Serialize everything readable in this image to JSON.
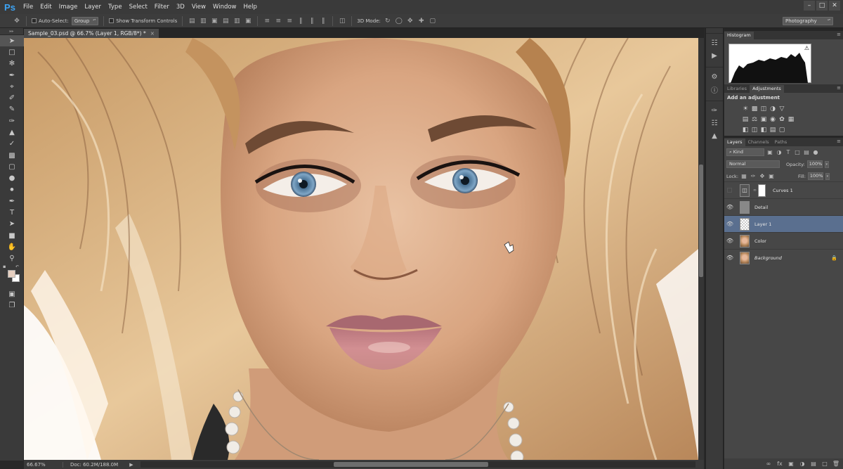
{
  "app": {
    "logo": "Ps"
  },
  "menu": [
    "File",
    "Edit",
    "Image",
    "Layer",
    "Type",
    "Select",
    "Filter",
    "3D",
    "View",
    "Window",
    "Help"
  ],
  "window_controls": {
    "minimize": "–",
    "restore": "□",
    "close": "✕"
  },
  "options": {
    "auto_select_label": "Auto-Select:",
    "auto_select_value": "Group",
    "show_transform_label": "Show Transform Controls",
    "mode_3d_label": "3D Mode:",
    "workspace": "Photography"
  },
  "document": {
    "tab_title": "Sample_03.psd @ 66.7% (Layer 1, RGB/8*) *",
    "close": "×"
  },
  "status": {
    "zoom": "66.67%",
    "doc": "Doc: 60.2M/188.0M",
    "arrow": "▶"
  },
  "histogram": {
    "tab": "Histogram",
    "warning_icon": "⚠"
  },
  "adjustments": {
    "tabs": [
      "Libraries",
      "Adjustments"
    ],
    "title": "Add an adjustment"
  },
  "layers": {
    "tabs": [
      "Layers",
      "Channels",
      "Paths"
    ],
    "kind": "⌕ Kind",
    "blend_mode": "Normal",
    "opacity_label": "Opacity:",
    "opacity_value": "100%",
    "lock_label": "Lock:",
    "fill_label": "Fill:",
    "fill_value": "100%",
    "items": [
      {
        "name": "Curves 1",
        "visible": false
      },
      {
        "name": "Detail",
        "visible": true
      },
      {
        "name": "Layer 1",
        "visible": true,
        "selected": true
      },
      {
        "name": "Color",
        "visible": true
      },
      {
        "name": "Background",
        "visible": true,
        "locked": true
      }
    ]
  },
  "colors": {
    "foreground": "#e6cfc0",
    "background": "#ffffff",
    "selected_layer": "#5a6f8f",
    "accent": "#3da4f5"
  }
}
